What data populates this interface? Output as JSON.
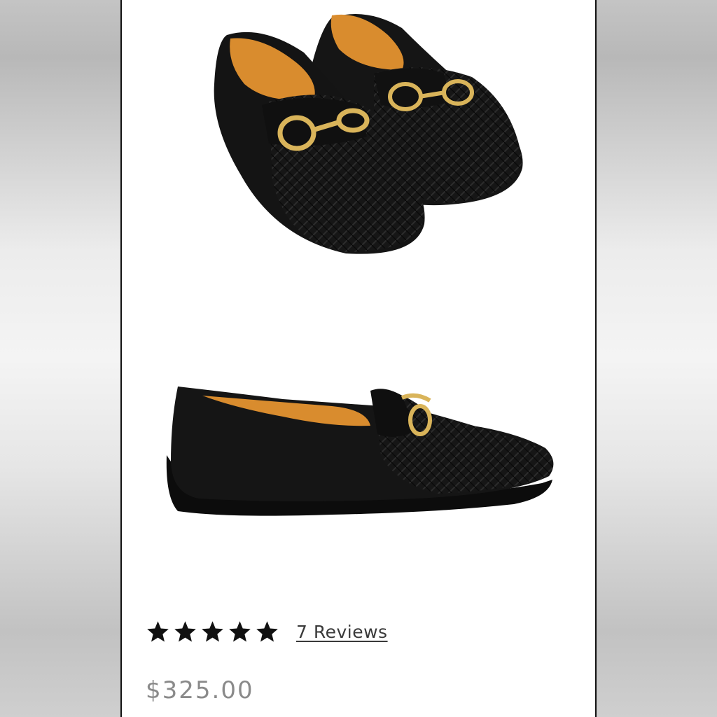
{
  "product": {
    "rating": {
      "stars": 5,
      "max": 5
    },
    "reviews_label": "7 Reviews",
    "price": "$325.00"
  },
  "colors": {
    "shoe": "#141414",
    "lining": "#d98c2e",
    "hardware": "#d9b45a",
    "price_text": "#8a8a8a"
  },
  "icons": [
    "star-icon"
  ]
}
